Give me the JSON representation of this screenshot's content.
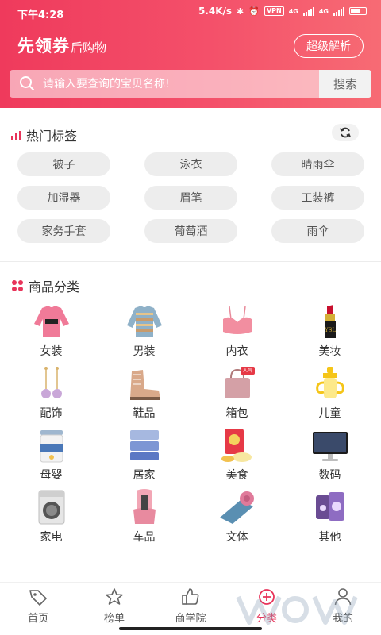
{
  "status_bar": {
    "time": "下午4:28",
    "net_speed": "5.4K/s",
    "vpn": "VPN",
    "net_type_1": "4G",
    "net_type_2": "4G"
  },
  "header": {
    "brand_main": "先领券",
    "brand_sub": "后购物",
    "super_button": "超级解析"
  },
  "search": {
    "placeholder": "请输入要查询的宝贝名称!",
    "button": "搜索"
  },
  "hot_tags": {
    "title": "热门标签",
    "tags": [
      "被子",
      "泳衣",
      "晴雨伞",
      "加湿器",
      "眉笔",
      "工装裤",
      "家务手套",
      "葡萄酒",
      "雨伞"
    ]
  },
  "categories": {
    "title": "商品分类",
    "items": [
      {
        "label": "女装",
        "icon": "pink-sweater-icon"
      },
      {
        "label": "男装",
        "icon": "striped-sweater-icon"
      },
      {
        "label": "内衣",
        "icon": "bra-icon"
      },
      {
        "label": "美妆",
        "icon": "lipstick-icon"
      },
      {
        "label": "配饰",
        "icon": "earrings-icon"
      },
      {
        "label": "鞋品",
        "icon": "boots-icon"
      },
      {
        "label": "箱包",
        "icon": "handbag-icon"
      },
      {
        "label": "儿童",
        "icon": "sippy-cup-icon"
      },
      {
        "label": "母婴",
        "icon": "milk-powder-icon"
      },
      {
        "label": "居家",
        "icon": "bedding-icon"
      },
      {
        "label": "美食",
        "icon": "snacks-icon"
      },
      {
        "label": "数码",
        "icon": "monitor-icon"
      },
      {
        "label": "家电",
        "icon": "washing-machine-icon"
      },
      {
        "label": "车品",
        "icon": "car-seat-icon"
      },
      {
        "label": "文体",
        "icon": "yoga-mat-icon"
      },
      {
        "label": "其他",
        "icon": "supplements-icon"
      }
    ]
  },
  "bottom_nav": [
    {
      "label": "首页",
      "icon": "tag-icon"
    },
    {
      "label": "榜单",
      "icon": "star-icon"
    },
    {
      "label": "商学院",
      "icon": "thumbs-up-icon"
    },
    {
      "label": "分类",
      "icon": "category-icon",
      "active": true
    },
    {
      "label": "我的",
      "icon": "user-icon"
    }
  ],
  "colors": {
    "brand": "#ef3a5c",
    "active": "#e8345a"
  }
}
